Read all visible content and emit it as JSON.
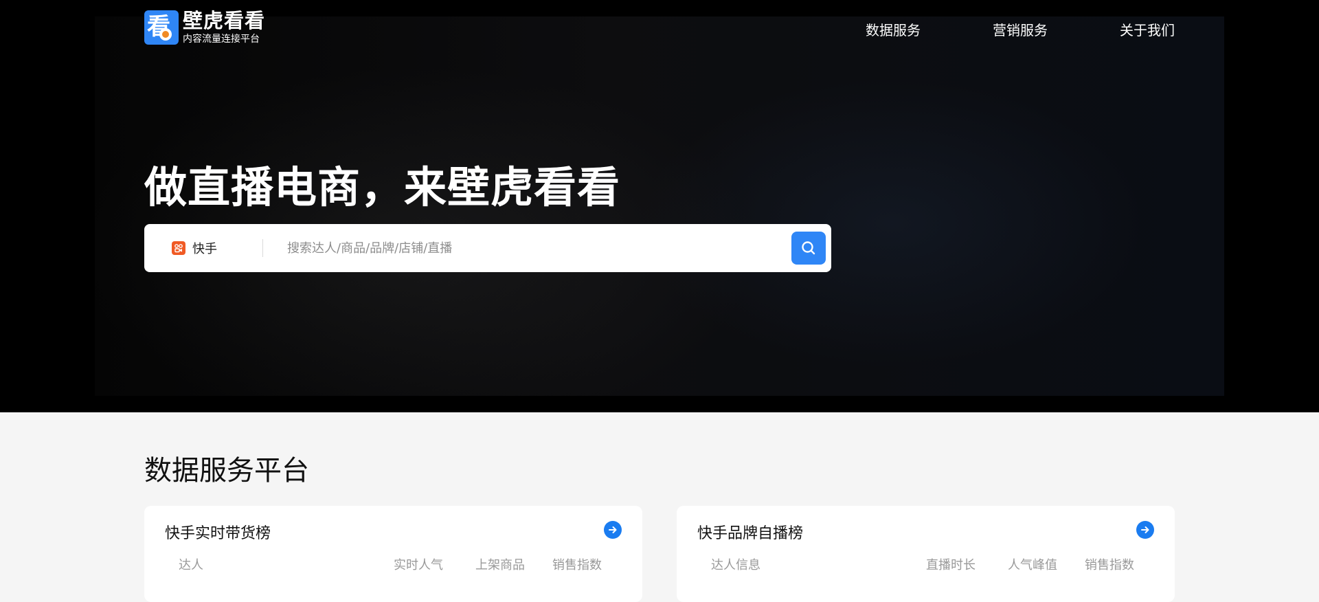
{
  "brand": {
    "name": "壁虎看看",
    "tagline": "内容流量连接平台",
    "logo_glyph": "看",
    "color_primary": "#2f86f6",
    "color_accent": "#f08a24"
  },
  "nav": {
    "items": [
      {
        "label": "数据服务"
      },
      {
        "label": "营销服务"
      },
      {
        "label": "关于我们"
      }
    ]
  },
  "hero": {
    "headline": "做直播电商，来壁虎看看"
  },
  "search": {
    "platform_label": "快手",
    "platform_icon": "kuaishou-icon",
    "placeholder": "搜索达人/商品/品牌/店铺/直播",
    "value": "",
    "button_icon": "search-icon"
  },
  "data_section": {
    "title": "数据服务平台",
    "cards": [
      {
        "title": "快手实时带货榜",
        "columns": [
          "达人",
          "实时人气",
          "上架商品",
          "销售指数"
        ]
      },
      {
        "title": "快手品牌自播榜",
        "columns": [
          "达人信息",
          "直播时长",
          "人气峰值",
          "销售指数"
        ]
      }
    ]
  }
}
